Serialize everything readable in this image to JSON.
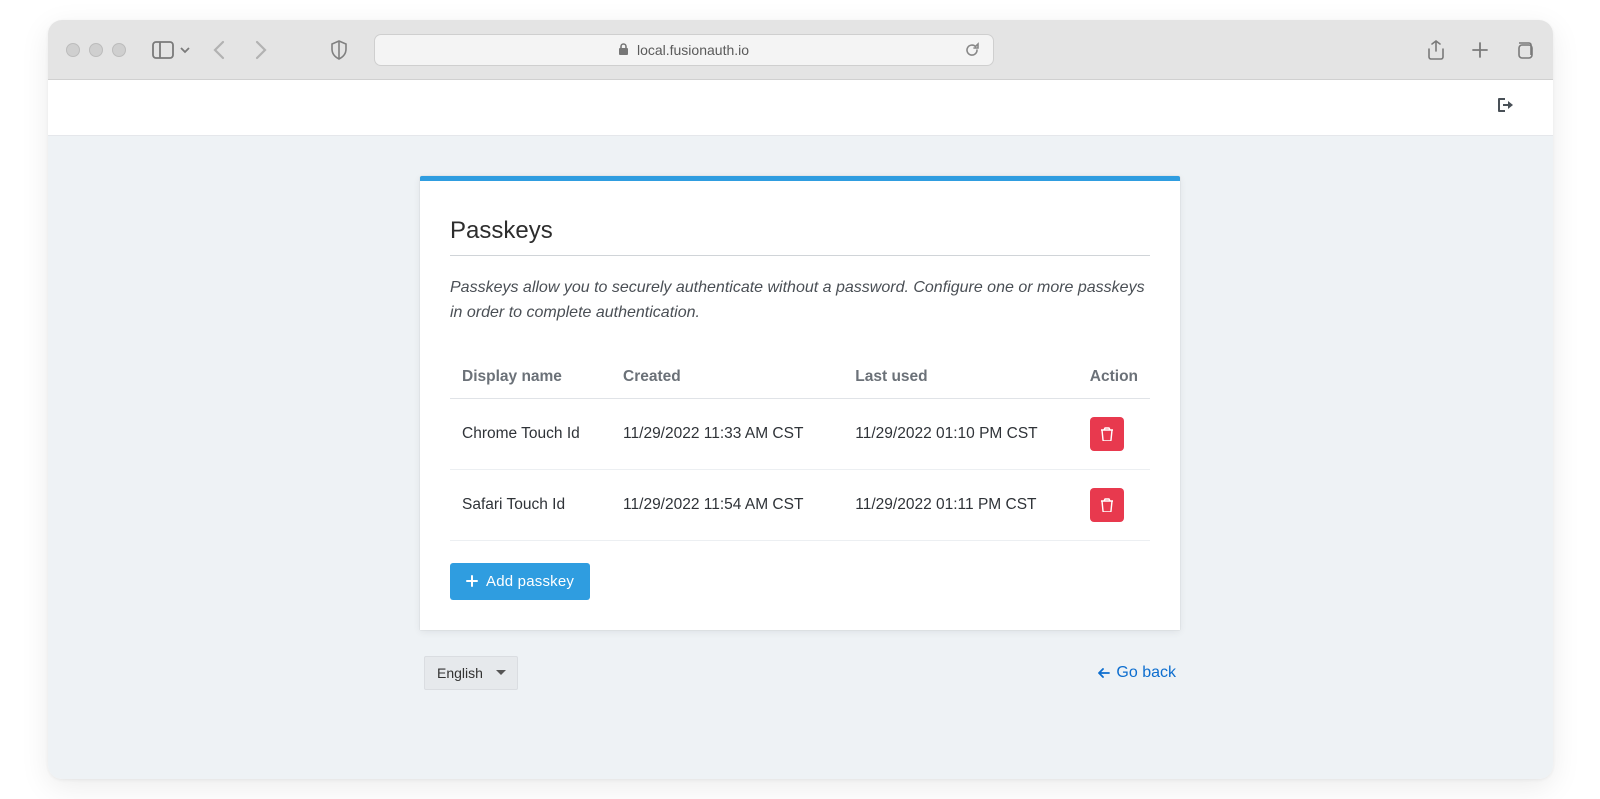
{
  "browser": {
    "url": "local.fusionauth.io"
  },
  "panel": {
    "title": "Passkeys",
    "description": "Passkeys allow you to securely authenticate without a password. Configure one or more passkeys in order to complete authentication.",
    "columns": {
      "name": "Display name",
      "created": "Created",
      "last_used": "Last used",
      "action": "Action"
    },
    "rows": [
      {
        "name": "Chrome Touch Id",
        "created": "11/29/2022 11:33 AM CST",
        "last_used": "11/29/2022 01:10 PM CST"
      },
      {
        "name": "Safari Touch Id",
        "created": "11/29/2022 11:54 AM CST",
        "last_used": "11/29/2022 01:11 PM CST"
      }
    ],
    "add_label": "Add passkey"
  },
  "footer": {
    "language": "English",
    "go_back": "Go back"
  }
}
